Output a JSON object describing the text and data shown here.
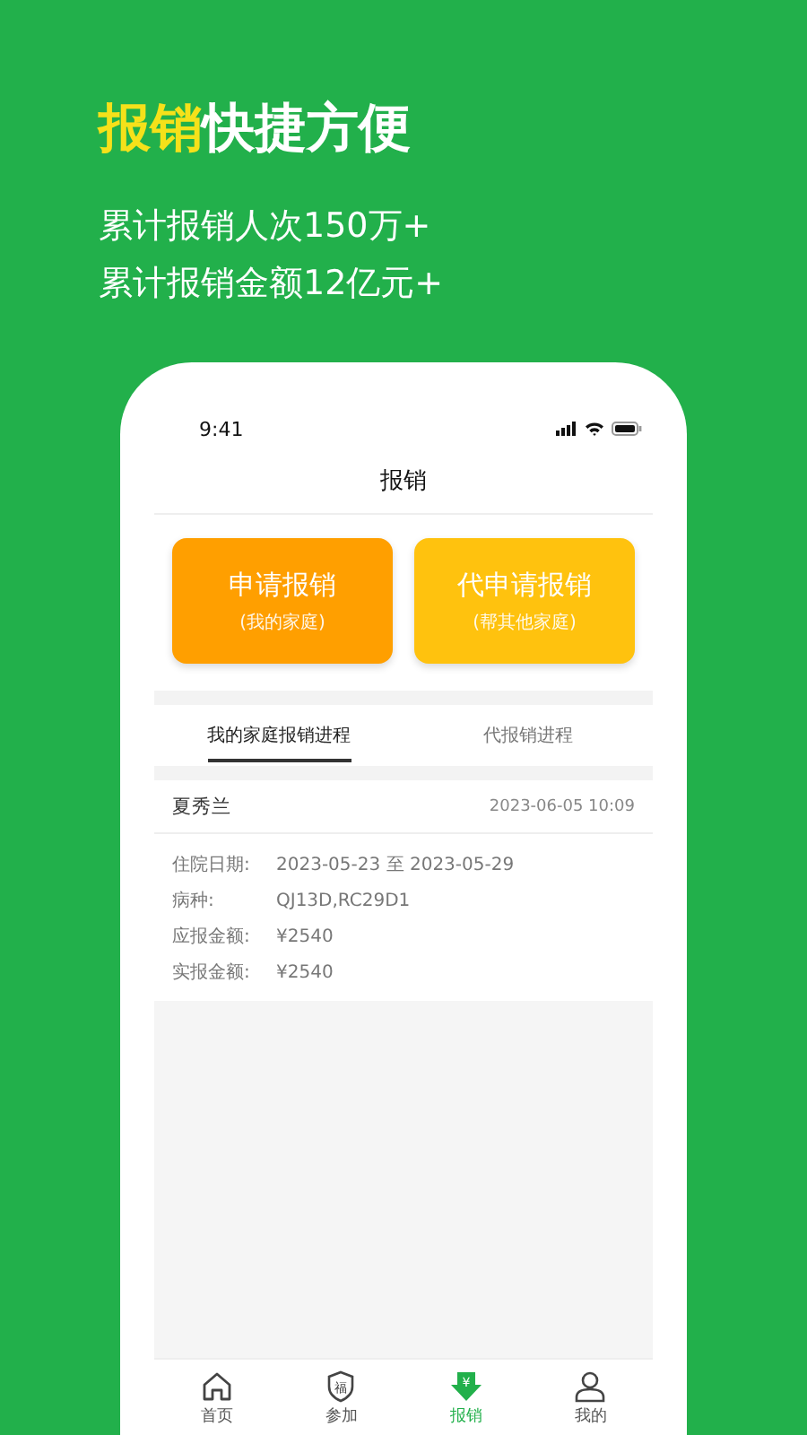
{
  "headline": {
    "highlight": "报销",
    "rest": "快捷方便"
  },
  "stats": [
    "累计报销人次150万+",
    "累计报销金额12亿元+"
  ],
  "phone": {
    "status_bar": {
      "time": "9:41"
    },
    "page_title": "报销",
    "actions": [
      {
        "kind": "primary",
        "title": "申请报销",
        "subtitle": "(我的家庭)"
      },
      {
        "kind": "secondary",
        "title": "代申请报销",
        "subtitle": "(帮其他家庭)"
      }
    ],
    "tabs": [
      {
        "label": "我的家庭报销进程",
        "selected": true
      },
      {
        "label": "代报销进程",
        "selected": false
      }
    ],
    "record": {
      "name": "夏秀兰",
      "time": "2023-06-05  10:09",
      "fields": [
        {
          "label": "住院日期:",
          "value": "2023-05-23 至 2023-05-29"
        },
        {
          "label": "病种:",
          "value": "QJ13D,RC29D1"
        },
        {
          "label": "应报金额:",
          "value": "¥2540"
        },
        {
          "label": "实报金额:",
          "value": "¥2540"
        }
      ]
    },
    "bottom_nav": [
      {
        "kind": "home",
        "label": "首页",
        "selected": false
      },
      {
        "kind": "shield",
        "label": "参加",
        "glyph": "福",
        "selected": false
      },
      {
        "kind": "claim",
        "label": "报销",
        "glyph": "¥",
        "selected": true
      },
      {
        "kind": "user",
        "label": "我的",
        "selected": false
      }
    ]
  }
}
